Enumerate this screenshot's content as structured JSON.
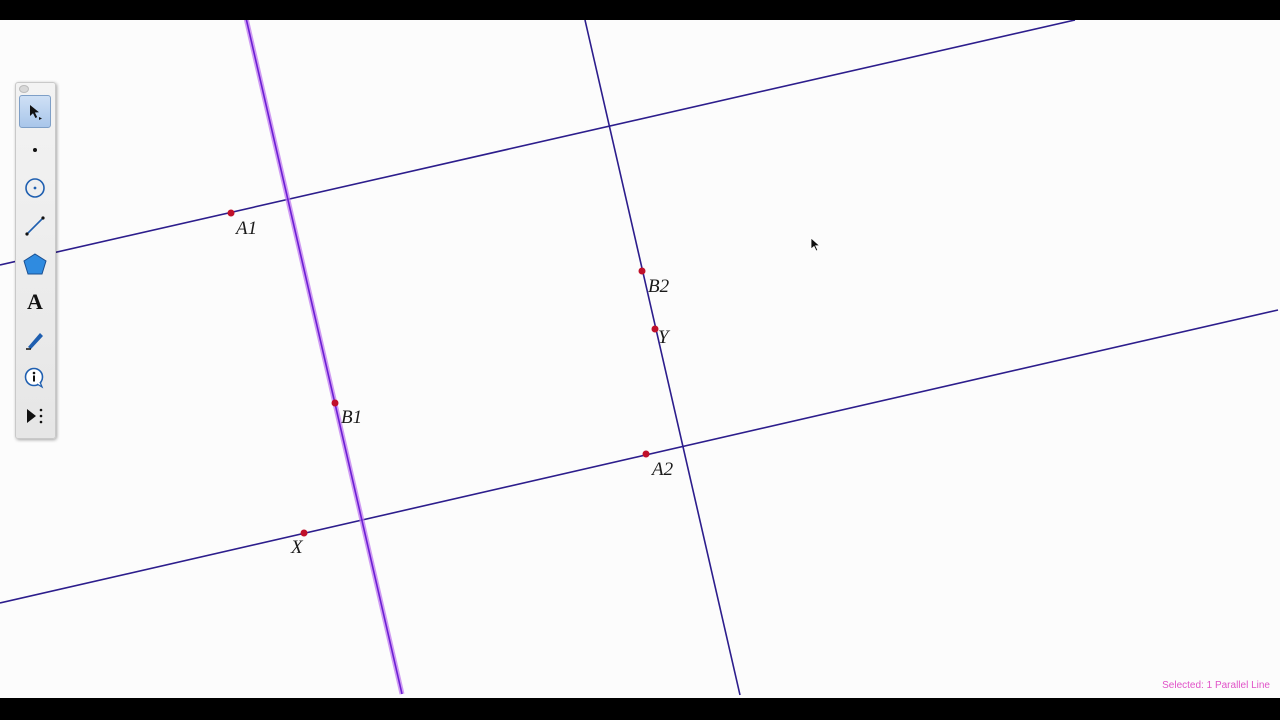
{
  "points": [
    {
      "id": "A1",
      "label": "A1"
    },
    {
      "id": "B1",
      "label": "B1"
    },
    {
      "id": "B2",
      "label": "B2"
    },
    {
      "id": "Y",
      "label": "Y"
    },
    {
      "id": "A2",
      "label": "A2"
    },
    {
      "id": "X",
      "label": "X"
    }
  ],
  "toolbox": {
    "tools": [
      {
        "name": "selection-arrow-tool",
        "active": true
      },
      {
        "name": "point-tool",
        "active": false
      },
      {
        "name": "compass-tool",
        "active": false
      },
      {
        "name": "straightedge-tool",
        "active": false
      },
      {
        "name": "polygon-tool",
        "active": false
      },
      {
        "name": "text-tool",
        "active": false,
        "glyph": "A"
      },
      {
        "name": "marker-tool",
        "active": false
      },
      {
        "name": "information-tool",
        "active": false
      },
      {
        "name": "custom-tools-menu",
        "active": false
      }
    ]
  },
  "status": {
    "text": "Selected: 1 Parallel Line"
  },
  "colors": {
    "line": "#2c1d8c",
    "selected_line": "#8a2be2",
    "point": "#c0102a",
    "status_text": "#e052c8",
    "canvas": "#fcfcfc"
  }
}
